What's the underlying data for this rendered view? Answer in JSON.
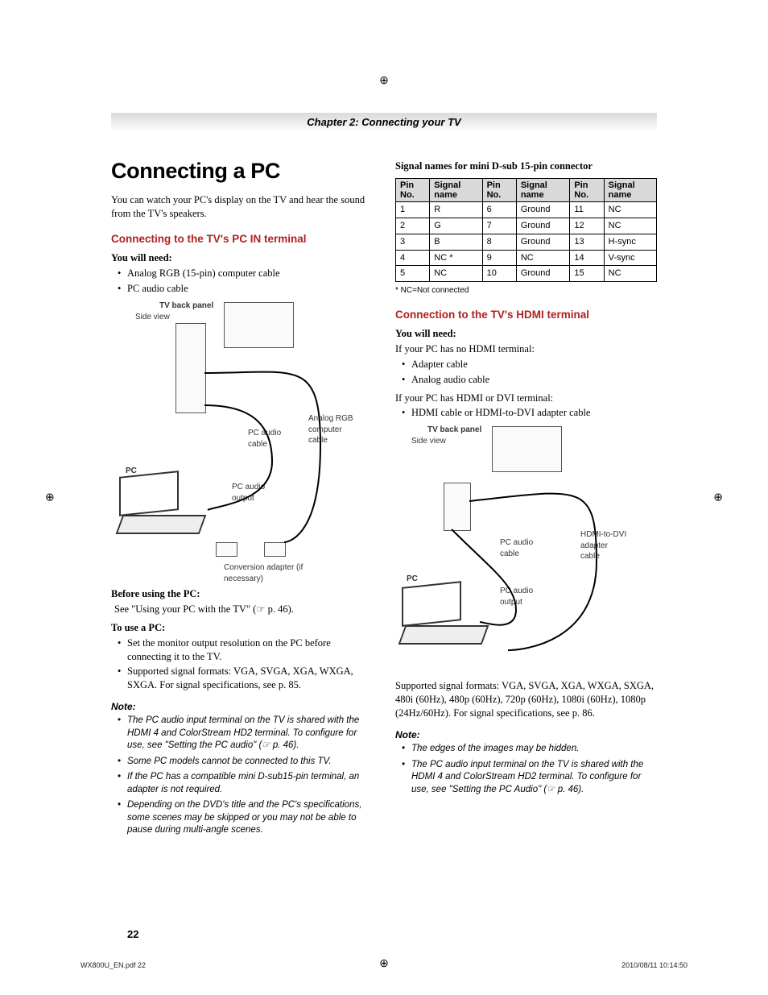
{
  "chapter": "Chapter 2: Connecting your TV",
  "title": "Connecting a PC",
  "intro": "You can watch your PC's display on the TV and hear the sound from the TV's speakers.",
  "sec_pcin": {
    "heading": "Connecting to the TV's PC IN terminal",
    "need_label": "You will need:",
    "need_items": [
      "Analog RGB (15-pin) computer cable",
      "PC audio cable"
    ],
    "before_label": "Before using the PC:",
    "before_text": "See \"Using your PC with the TV\" (☞ p. 46).",
    "use_label": "To use a PC:",
    "use_items": [
      "Set the monitor output resolution on the PC before connecting it to the TV.",
      "Supported signal formats: VGA, SVGA, XGA, WXGA, SXGA. For signal specifications, see p. 85."
    ],
    "note_label": "Note:",
    "notes": [
      "The PC audio input terminal on the TV is shared with the HDMI 4 and ColorStream HD2 terminal. To configure for use, see \"Setting the PC audio\" (☞ p. 46).",
      "Some PC models cannot be connected to this TV.",
      "If the PC has a compatible mini D-sub15-pin terminal, an adapter is not required.",
      "Depending on the DVD's title and the PC's specifications, some scenes may be skipped or you may not be able to pause during multi-angle scenes."
    ]
  },
  "diagram1_labels": {
    "tv_back": "TV back panel",
    "side": "Side view",
    "pc": "PC",
    "pc_audio_cable": "PC audio cable",
    "rgb_cable": "Analog RGB computer cable",
    "pc_audio_out": "PC audio output",
    "conv": "Conversion adapter (if necessary)"
  },
  "table_caption": "Signal names for mini D-sub 15-pin connector",
  "table_headers": {
    "pin": "Pin No.",
    "signal": "Signal name"
  },
  "pin_rows": [
    [
      "1",
      "R",
      "6",
      "Ground",
      "11",
      "NC"
    ],
    [
      "2",
      "G",
      "7",
      "Ground",
      "12",
      "NC"
    ],
    [
      "3",
      "B",
      "8",
      "Ground",
      "13",
      "H-sync"
    ],
    [
      "4",
      "NC *",
      "9",
      "NC",
      "14",
      "V-sync"
    ],
    [
      "5",
      "NC",
      "10",
      "Ground",
      "15",
      "NC"
    ]
  ],
  "nc_note": "* NC=Not connected",
  "sec_hdmi": {
    "heading": "Connection to the TV's HDMI terminal",
    "need_label": "You will need:",
    "line1": "If your PC has no HDMI terminal:",
    "items1": [
      "Adapter cable",
      "Analog audio cable"
    ],
    "line2": "If your PC has HDMI or DVI terminal:",
    "items2": [
      "HDMI cable or HDMI-to-DVI adapter cable"
    ],
    "supported": "Supported signal formats: VGA, SVGA, XGA, WXGA, SXGA, 480i (60Hz), 480p (60Hz), 720p (60Hz), 1080i (60Hz), 1080p (24Hz/60Hz). For signal specifications, see p. 86.",
    "note_label": "Note:",
    "notes": [
      "The edges of the images may be hidden.",
      "The PC audio input terminal on the TV is shared with the HDMI 4 and ColorStream HD2 terminal. To configure for use, see \"Setting the PC Audio\" (☞ p. 46)."
    ]
  },
  "diagram2_labels": {
    "tv_back": "TV back panel",
    "side": "Side view",
    "pc": "PC",
    "pc_audio_cable": "PC audio cable",
    "hdmi_cable": "HDMI-to-DVI adapter cable",
    "pc_audio_out": "PC audio output"
  },
  "page_number": "22",
  "footer_left": "WX800U_EN.pdf   22",
  "footer_right": "2010/08/11   10:14:50"
}
